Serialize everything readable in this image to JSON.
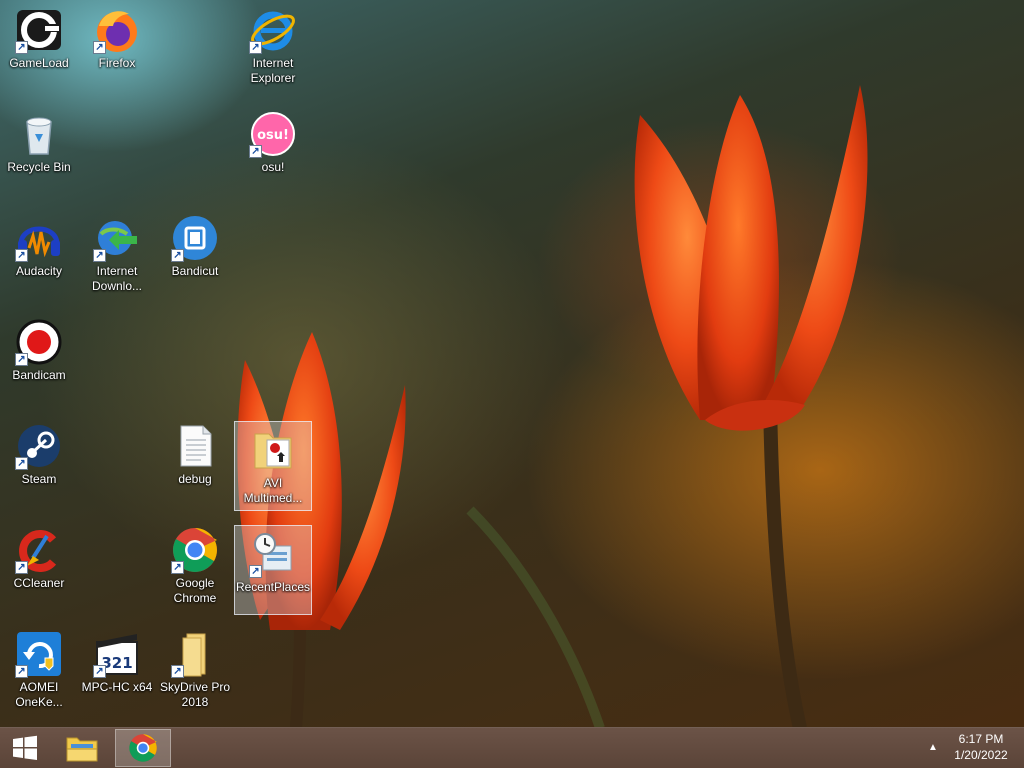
{
  "desktop": {
    "icons": [
      {
        "label": "GameLoad",
        "icon": "gameload-icon"
      },
      {
        "label": "Firefox",
        "icon": "firefox-icon"
      },
      {
        "label": "Internet\nExplorer",
        "icon": "internet-explorer-icon"
      },
      {
        "label": "Recycle Bin",
        "icon": "recycle-bin-icon"
      },
      {
        "label": "osu!",
        "icon": "osu-icon"
      },
      {
        "label": "Audacity",
        "icon": "audacity-icon"
      },
      {
        "label": "Internet\nDownlo...",
        "icon": "internet-download-manager-icon"
      },
      {
        "label": "Bandicut",
        "icon": "bandicut-icon"
      },
      {
        "label": "Bandicam",
        "icon": "bandicam-icon"
      },
      {
        "label": "Steam",
        "icon": "steam-icon"
      },
      {
        "label": "debug",
        "icon": "text-file-icon"
      },
      {
        "label": "AVI\nMultimed...",
        "icon": "avi-folder-icon"
      },
      {
        "label": "CCleaner",
        "icon": "ccleaner-icon"
      },
      {
        "label": "Google\nChrome",
        "icon": "chrome-icon"
      },
      {
        "label": "RecentPlaces",
        "icon": "recent-places-icon"
      },
      {
        "label": "AOMEI\nOneKe...",
        "icon": "aomei-onekey-icon"
      },
      {
        "label": "MPC-HC x64",
        "icon": "mpc-hc-icon"
      },
      {
        "label": "SkyDrive Pro\n2018",
        "icon": "skydrive-pro-icon"
      }
    ]
  },
  "taskbar": {
    "start_icon": "windows-start-icon",
    "pinned": [
      {
        "name": "file-explorer",
        "icon": "folder-icon",
        "active": false
      },
      {
        "name": "google-chrome",
        "icon": "chrome-icon",
        "active": true
      }
    ],
    "tray_arrow": "▲",
    "clock": {
      "time": "6:17 PM",
      "date": "1/20/2022"
    }
  },
  "colors": {
    "taskbar": "#5f4a3e",
    "selection": "#dce1eb",
    "accent_red": "#e8401a"
  }
}
